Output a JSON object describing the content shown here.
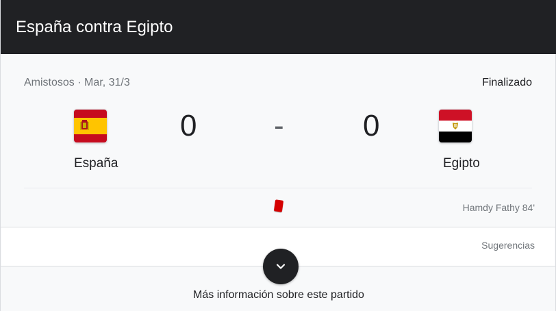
{
  "header": {
    "title": "España contra Egipto"
  },
  "match": {
    "meta": "Amistosos · Mar, 31/3",
    "status": "Finalizado",
    "home": {
      "name": "España",
      "score": "0",
      "flag": "spain-flag"
    },
    "away": {
      "name": "Egipto",
      "score": "0",
      "flag": "egypt-flag"
    },
    "separator": "-"
  },
  "events": [
    {
      "type": "red-card-icon",
      "text": "Hamdy Fathy 84'"
    }
  ],
  "suggestions_label": "Sugerencias",
  "more_info_label": "Más información sobre este partido",
  "colors": {
    "header_bg": "#202124",
    "red_card": "#d50000",
    "spain_red": "#c60b1e",
    "spain_yellow": "#ffc400",
    "egypt_red": "#ce1126",
    "egypt_black": "#000000"
  }
}
